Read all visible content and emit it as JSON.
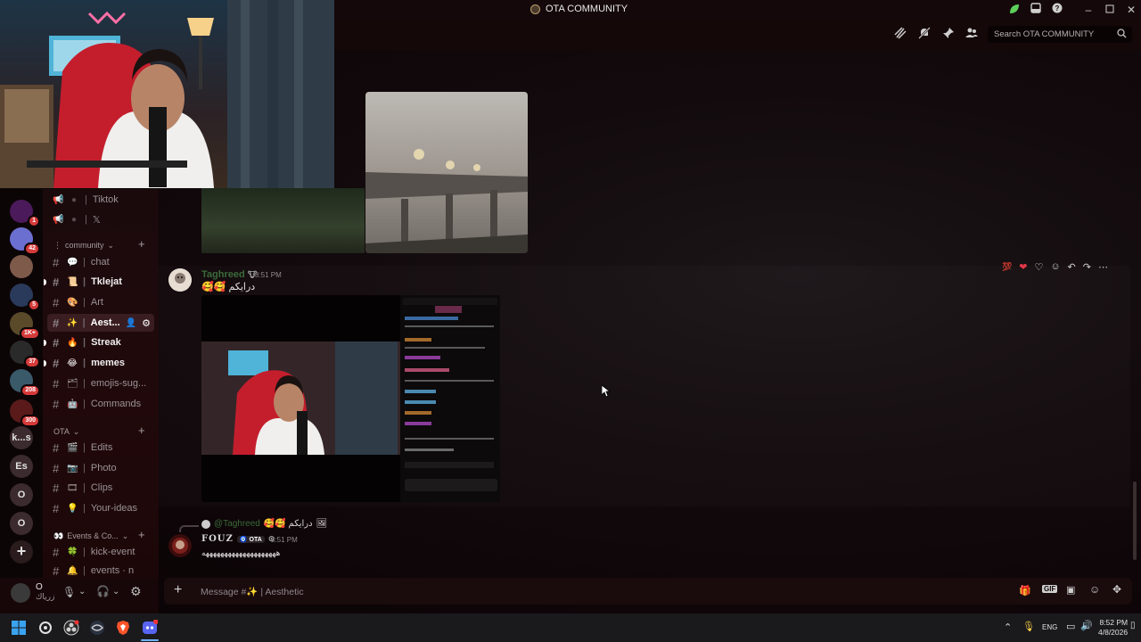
{
  "window": {
    "title": "OTA COMMUNITY"
  },
  "header": {
    "search_placeholder": "Search OTA COMMUNITY"
  },
  "rail": {
    "servers": [
      {
        "badge": "1"
      },
      {
        "badge": "42"
      },
      {
        "badge": ""
      },
      {
        "badge": "5"
      },
      {
        "badge": "1K+"
      },
      {
        "badge": "37"
      },
      {
        "badge": "208"
      },
      {
        "badge": "300"
      },
      {
        "label": "k...s"
      },
      {
        "label": "Es"
      },
      {
        "label": "O"
      },
      {
        "label": "O"
      }
    ]
  },
  "sidebar": {
    "top_channels": [
      {
        "name": "Tiktok"
      },
      {
        "name": "𝕏"
      }
    ],
    "category_community": "community",
    "community_channels": [
      {
        "emoji": "💬",
        "name": "chat"
      },
      {
        "emoji": "📜",
        "name": "Tklejat"
      },
      {
        "emoji": "🎨",
        "name": "Art"
      },
      {
        "emoji": "✨",
        "name": "Aest..."
      },
      {
        "emoji": "🔥",
        "name": "Streak"
      },
      {
        "emoji": "😂",
        "name": "memes"
      },
      {
        "emoji": "🗂",
        "name": "emojis-sug..."
      },
      {
        "emoji": "🤖",
        "name": "Commands"
      }
    ],
    "category_ota": "OTA",
    "ota_channels": [
      {
        "emoji": "🎬",
        "name": "Edits"
      },
      {
        "emoji": "📷",
        "name": "Photo"
      },
      {
        "emoji": "🎞",
        "name": "Clips"
      },
      {
        "emoji": "💡",
        "name": "Your-ideas"
      }
    ],
    "category_events": "Events & Co...",
    "events_channels": [
      {
        "emoji": "🍀",
        "name": "kick-event"
      },
      {
        "emoji": "🔔",
        "name": "events · n"
      }
    ]
  },
  "user": {
    "name": "O",
    "status": "زرياك"
  },
  "messages": [
    {
      "author": "Taghreed",
      "author_emoji": "🐮",
      "time": "8:51 PM",
      "text": "🥰🥰 درايكم",
      "author_color": "#3b6b3a"
    },
    {
      "reply_to": "@Taghreed",
      "reply_text": "🥰🥰 درايكم",
      "author": "FOUZ",
      "tag": "OTA",
      "time": "8:51 PM",
      "text": "ههههههههههههههههههههه",
      "author_color": "#d8d8d8"
    }
  ],
  "composer": {
    "placeholder": "Message #✨ | Aesthetic"
  },
  "taskbar": {
    "language": "ENG",
    "time": "8:52 PM",
    "date": "4/8/2026"
  }
}
